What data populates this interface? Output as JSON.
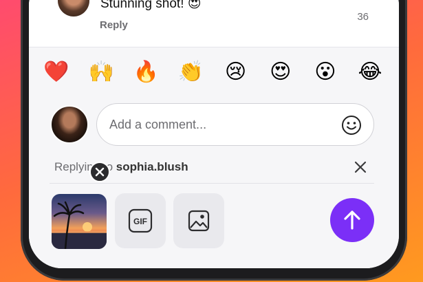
{
  "comment": {
    "text": "Stunning shot! 😍",
    "reply_label": "Reply",
    "like_count": "36"
  },
  "reactions": [
    "❤️",
    "🙌",
    "🔥",
    "👏",
    "😢",
    "😍",
    "😮",
    "😂"
  ],
  "composer": {
    "placeholder": "Add a comment...",
    "replying_prefix": "Replying to",
    "replying_username": "sophia.blush"
  },
  "toolbar": {
    "gif_label": "GIF"
  },
  "colors": {
    "accent": "#7b2ff7",
    "background_gradient_start": "#ff4b6e",
    "background_gradient_end": "#ff9a1f"
  },
  "icons": {
    "emoji_picker": "smiley-icon",
    "close_reply": "close-icon",
    "remove_attachment": "close-icon",
    "gif": "gif-icon",
    "image": "image-icon",
    "send": "arrow-up-icon"
  }
}
